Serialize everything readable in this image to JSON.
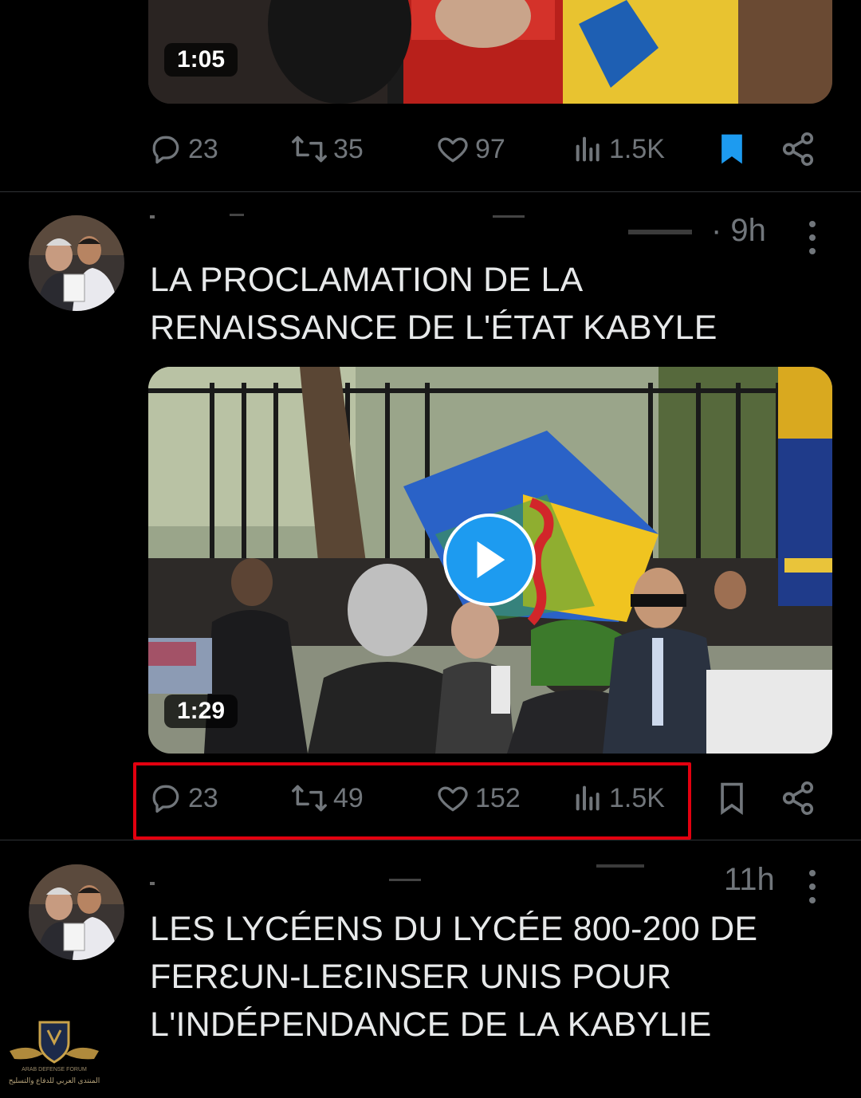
{
  "post1": {
    "video_duration": "1:05",
    "replies": "23",
    "reposts": "35",
    "likes": "97",
    "views": "1.5K",
    "bookmarked": true
  },
  "post2": {
    "time": "· 9h",
    "text": "LA PROCLAMATION DE LA RENAISSANCE DE L'ÉTAT KABYLE",
    "video_duration": "1:29",
    "replies": "23",
    "reposts": "49",
    "likes": "152",
    "views": "1.5K",
    "bookmarked": false
  },
  "post3": {
    "time": "11h",
    "text": "LES LYCÉENS DU LYCÉE 800-200 DE FERƐUN-LEƐINSER UNIS POUR L'INDÉPENDANCE DE LA KABYLIE"
  },
  "watermark": {
    "line1": "ARAB DEFENSE FORUM",
    "line2": "المنتدى العربي للدفاع والتسليح"
  },
  "colors": {
    "background": "#000000",
    "text": "#e7e9ea",
    "muted": "#71767b",
    "accent": "#1d9bf0",
    "highlight_box": "#e3000f"
  }
}
